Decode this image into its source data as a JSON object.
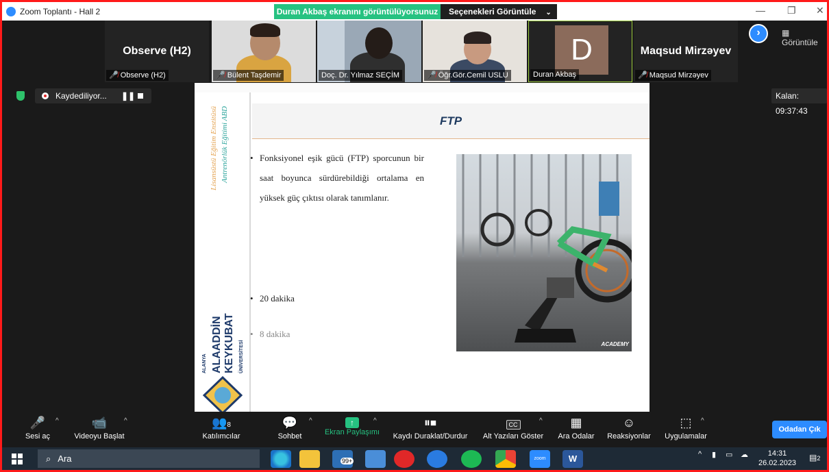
{
  "window": {
    "title": "Zoom Toplantı - Hall 2",
    "share_banner": "Duran Akbaş ekranını görüntülüyorsunuz",
    "view_options": "Seçenekleri Görüntüle",
    "minimize": "—",
    "restore": "❐",
    "close": "✕"
  },
  "participants": [
    {
      "display": "Observe (H2)",
      "label": "Observe (H2)",
      "muted": true,
      "kind": "name"
    },
    {
      "label": "Bülent Taşdemir",
      "muted": true,
      "kind": "video"
    },
    {
      "label": "Doç. Dr. Yılmaz SEÇİM",
      "muted": false,
      "kind": "video"
    },
    {
      "label": "Öğr.Gör.Cemil USLU",
      "muted": true,
      "kind": "video"
    },
    {
      "avatar_letter": "D",
      "label": "Duran Akbaş",
      "muted": false,
      "kind": "avatar"
    },
    {
      "display": "Maqsud Mirzəyev",
      "label": "Maqsud Mirzəyev",
      "muted": true,
      "kind": "name"
    }
  ],
  "gallery_label": "Görüntüle",
  "recording": {
    "status": "Kaydediliyor...",
    "pause_glyph": "❚❚"
  },
  "timer": "Kalan: 09:37:43",
  "slide": {
    "sidebar_text_1": "Lisansüstü Eğitim Enstitüsü",
    "sidebar_text_2": "Antrenörlük Eğitimi ABD",
    "logo_line_1": "ALANYA",
    "logo_line_2": "ALAADDİN",
    "logo_line_3": "KEYKUBAT",
    "logo_line_4": "ÜNİVERSİTESİ",
    "title": "FTP",
    "bullet_1": "Fonksiyonel eşik gücü (FTP) sporcunun bir saat boyunca sürdürebildiği ortalama en yüksek güç çıktısı olarak tanımlanır.",
    "bullet_2": "20 dakika",
    "bullet_3": "8 dakika",
    "bullet_glyph": "•",
    "photo_watermark": "ACADEMY"
  },
  "toolbar": {
    "mute_label": "Sesi aç",
    "video_label": "Videoyu Başlat",
    "participants_label": "Katılımcılar",
    "participants_count": "8",
    "chat_label": "Sohbet",
    "share_label": "Ekran Paylaşımı",
    "rec_label": "Kaydı Duraklat/Durdur",
    "cc_label": "Alt Yazıları Göster",
    "cc_icon": "CC",
    "rooms_label": "Ara Odalar",
    "reactions_label": "Reaksiyonlar",
    "apps_label": "Uygulamalar",
    "leave_label": "Odadan Çık"
  },
  "taskbar": {
    "search_placeholder": "Ara",
    "mail_badge": "99+",
    "time": "14:31",
    "date": "26.02.2023",
    "notif_count": "2",
    "zoom_app": "zoom",
    "word_app": "W"
  },
  "colors": {
    "accent": "#2d8cff",
    "share_green": "#26c281",
    "muted_red": "#e02828",
    "border_red": "#ff1a1a"
  }
}
